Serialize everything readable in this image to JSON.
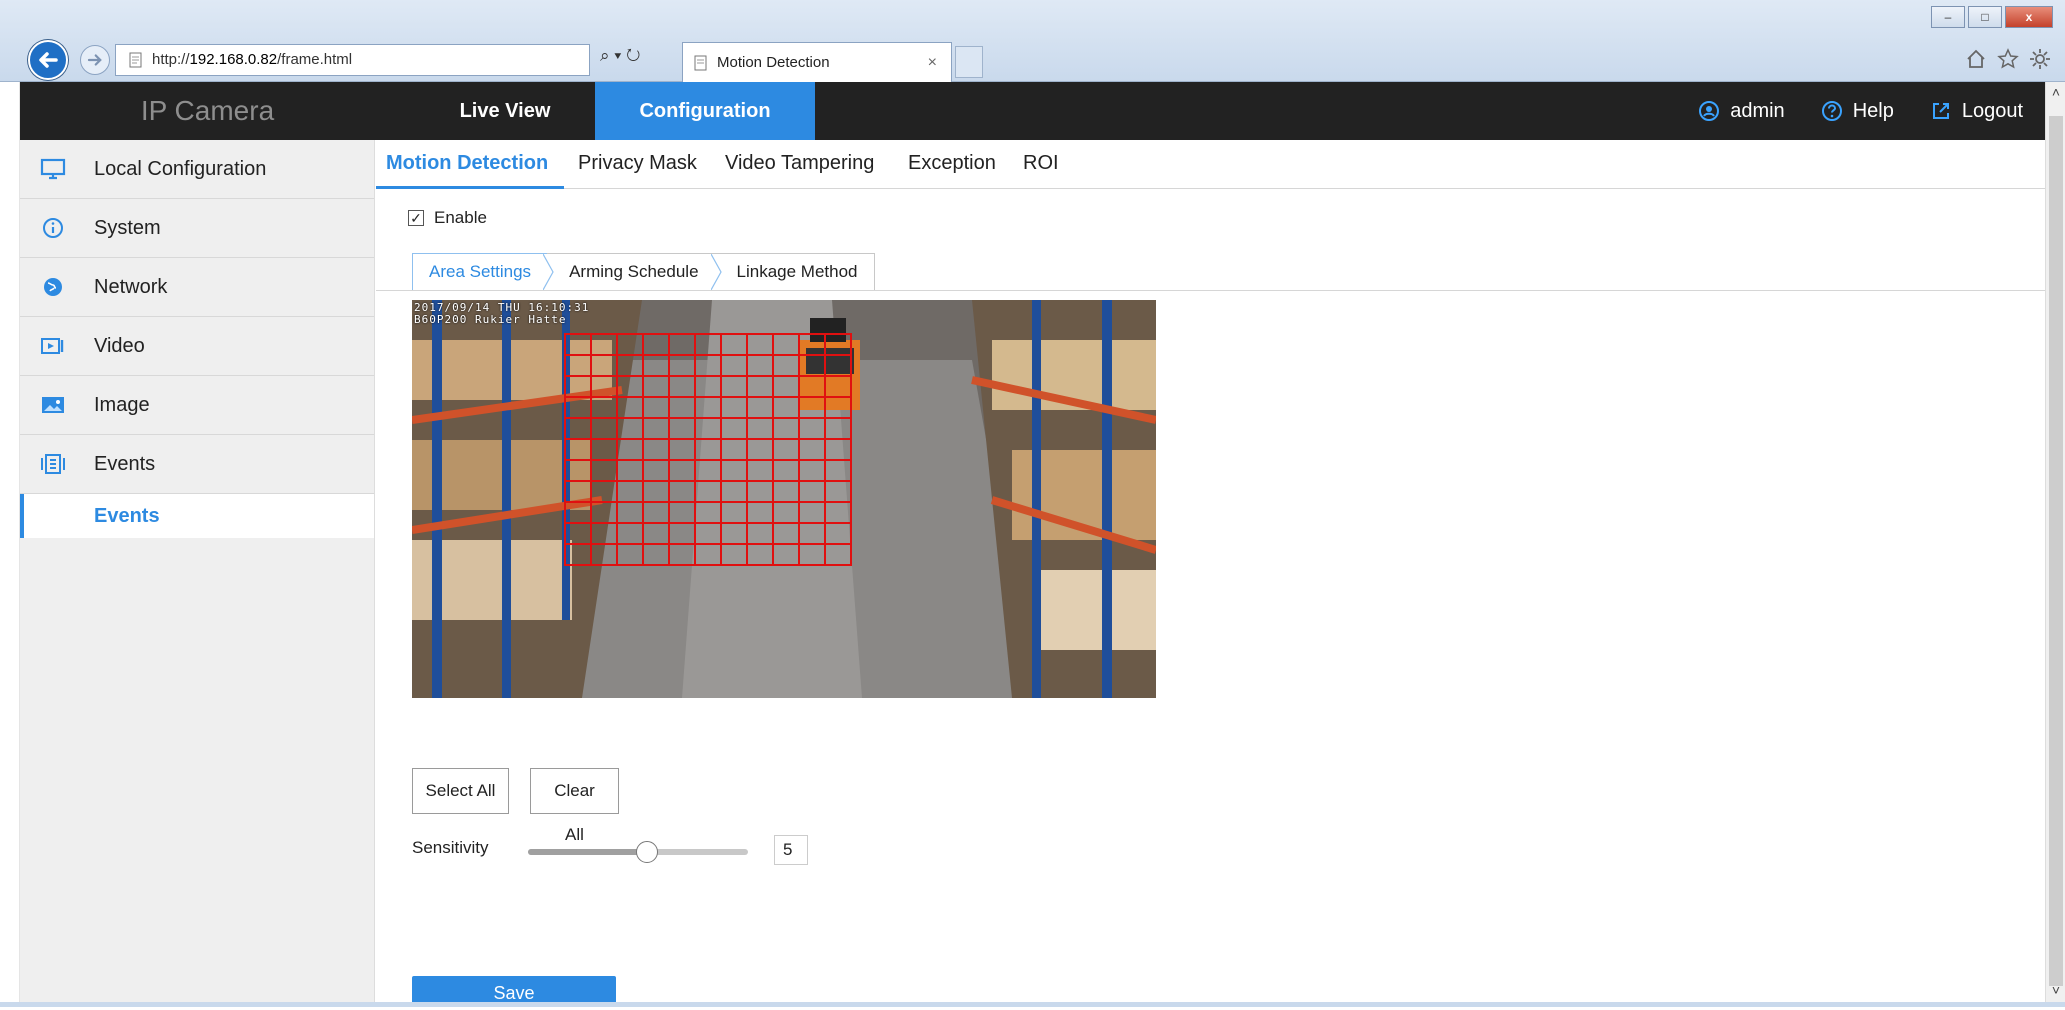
{
  "browser": {
    "address_prefix": "http://",
    "address_host": "192.168.0.82",
    "address_path": "/frame.html",
    "address_tools": "⌕ ▾ ↻",
    "tab_title": "Motion Detection",
    "tab_close": "×",
    "window_controls": {
      "minimize": "–",
      "maximize": "□",
      "close": "x"
    },
    "toolbar_icons": [
      "home-icon",
      "star-icon",
      "gear-icon"
    ]
  },
  "header": {
    "brand": "IP Camera",
    "nav": [
      {
        "label": "Live View",
        "active": false
      },
      {
        "label": "Configuration",
        "active": true
      }
    ],
    "user": "admin",
    "help": "Help",
    "logout": "Logout",
    "accent_color": "#2d8ae1"
  },
  "sidebar": {
    "items": [
      {
        "label": "Local Configuration",
        "icon": "monitor-icon"
      },
      {
        "label": "System",
        "icon": "info-icon"
      },
      {
        "label": "Network",
        "icon": "globe-icon"
      },
      {
        "label": "Video",
        "icon": "video-icon"
      },
      {
        "label": "Image",
        "icon": "image-icon"
      },
      {
        "label": "Events",
        "icon": "events-icon"
      }
    ],
    "active_sub": "Events"
  },
  "main": {
    "subtabs": [
      "Motion Detection",
      "Privacy Mask",
      "Video Tampering",
      "Exception",
      "ROI"
    ],
    "active_subtab": "Motion Detection",
    "enable_label": "Enable",
    "enable_checked": true,
    "steps": [
      "Area Settings",
      "Arming Schedule",
      "Linkage Method"
    ],
    "active_step": "Area Settings",
    "osd_line1": "2017/09/14 THU 16:10:31",
    "osd_line2": "B60P200 Rukier Hatte",
    "select_all": "Select All",
    "clear_all": "Clear All",
    "sensitivity_label": "Sensitivity",
    "sensitivity_value": "5",
    "sensitivity_fraction": 0.54,
    "save": "Save",
    "grid_color": "#e01010"
  }
}
